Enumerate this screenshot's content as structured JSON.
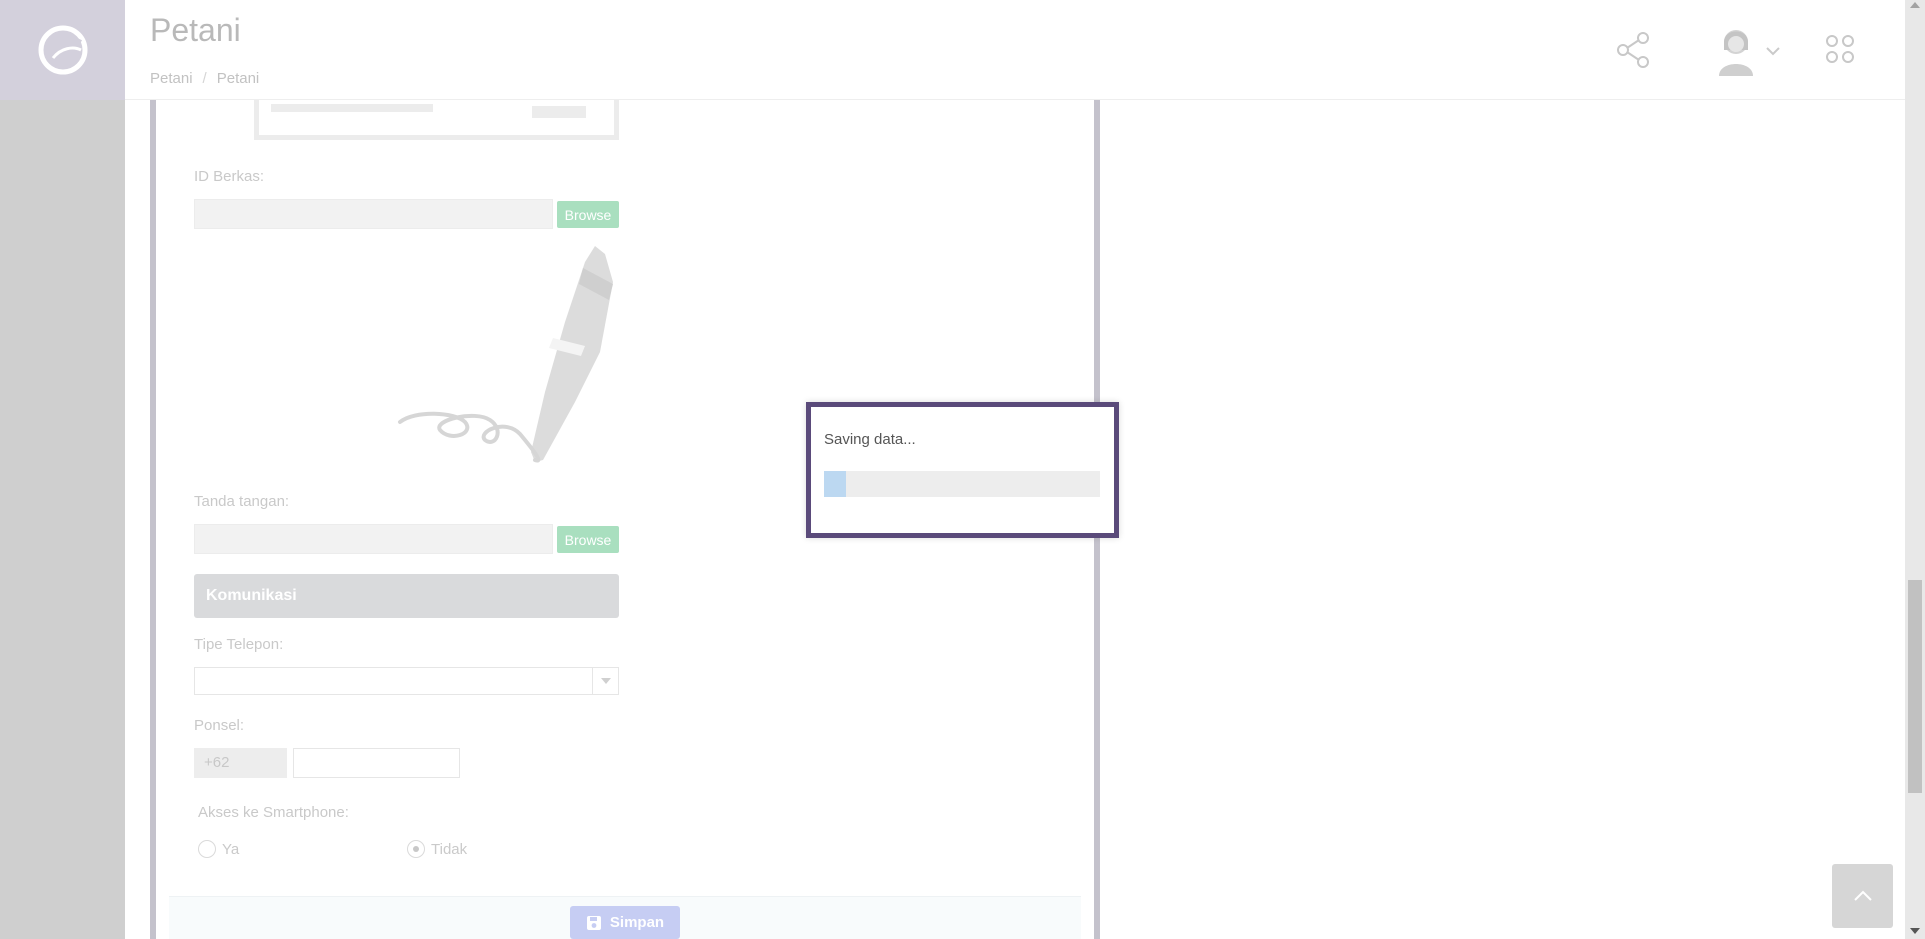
{
  "header": {
    "title": "Petani",
    "breadcrumb": [
      "Petani",
      "Petani"
    ],
    "breadcrumb_separator": "/"
  },
  "form": {
    "id_berkas_label": "ID Berkas:",
    "tanda_tangan_label": "Tanda tangan:",
    "browse_label": "Browse",
    "section_komunikasi": "Komunikasi",
    "tipe_telepon_label": "Tipe Telepon:",
    "tipe_telepon_value": "",
    "ponsel_label": "Ponsel:",
    "ponsel_prefix": "+62",
    "ponsel_value": "",
    "smartphone_label": "Akses ke Smartphone:",
    "smartphone_options": [
      {
        "label": "Ya",
        "checked": false
      },
      {
        "label": "Tidak",
        "checked": true
      }
    ],
    "save_label": "Simpan"
  },
  "modal": {
    "message": "Saving data...",
    "progress_percent": 8
  },
  "icons": {
    "logo": "petani-logo-icon",
    "share": "share-icon",
    "avatar": "avatar-icon",
    "apps": "apps-grid-icon",
    "save": "floppy-disk-icon",
    "back_to_top": "chevron-up-icon",
    "signature": "pen-signature-icon"
  },
  "colors": {
    "browse_button": "#a9dfbf",
    "save_button": "#c6cdf3",
    "modal_border": "#5a4a7a",
    "progress_fill": "#bcd8f1"
  }
}
